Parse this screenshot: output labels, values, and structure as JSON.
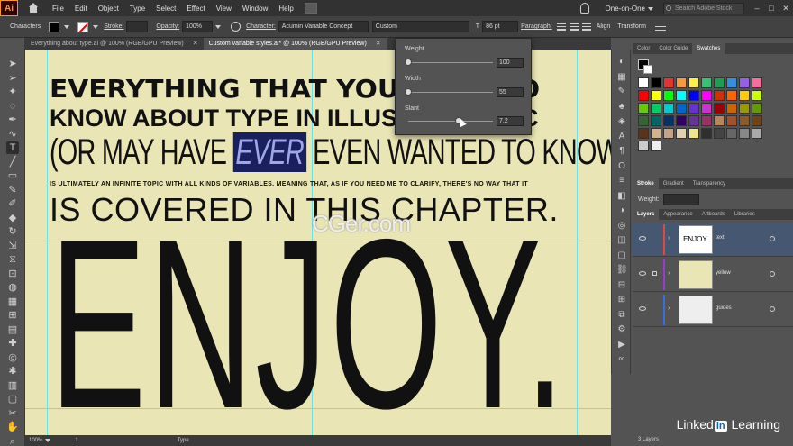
{
  "menubar": {
    "app_logo": "Ai",
    "items": [
      "File",
      "Edit",
      "Object",
      "Type",
      "Select",
      "Effect",
      "View",
      "Window",
      "Help"
    ],
    "workspace": "One-on-One",
    "search_placeholder": "Search Adobe Stock",
    "win_controls": [
      "–",
      "□",
      "✕"
    ]
  },
  "controlbar": {
    "panel_label": "Characters",
    "stroke_label": "Stroke:",
    "opacity_label": "Opacity:",
    "opacity_value": "100%",
    "character_label": "Character:",
    "font_name": "Acumin Variable Concept",
    "font_style": "Custom",
    "font_size": "86 pt",
    "paragraph_label": "Paragraph:",
    "align_label": "Align",
    "transform_label": "Transform"
  },
  "tabs": [
    {
      "label": "Everything about type.ai @ 100% (RGB/GPU Preview)",
      "close": "✕"
    },
    {
      "label": "Custom variable styles.ai* @ 100% (RGB/GPU Preview)",
      "close": "✕"
    }
  ],
  "popup": {
    "weight_label": "Weight",
    "weight_value": "100",
    "weight_fraction": 0.0,
    "width_label": "Width",
    "width_value": "55",
    "width_fraction": 0.0,
    "slant_label": "Slant",
    "slant_value": "7.2",
    "slant_fraction": 0.6
  },
  "artwork": {
    "line1": "EVERYTHING THAT YOU NEED TO",
    "line2": "KNOW ABOUT TYPE IN ILLUSTRATOR CC",
    "line3_before": "(OR MAY HAVE ",
    "line3_highlight": "EVER",
    "line3_after": " EVEN WANTED TO KNOW)",
    "line4": "IS ULTIMATELY AN INFINITE TOPIC WITH ALL KINDS OF VARIABLES. MEANING THAT, AS IF YOU NEED ME TO CLARIFY, THERE'S NO WAY THAT IT",
    "line5": "IS COVERED IN THIS CHAPTER.",
    "line6": "ENJOY.",
    "watermark": "CGer.com"
  },
  "rightpanel": {
    "top_tabs": [
      "Color",
      "Color Guide",
      "Swatches"
    ],
    "stroke_tabs": [
      "Stroke",
      "Gradient",
      "Transparency"
    ],
    "weight_label": "Weight:",
    "layers_tabs": [
      "Layers",
      "Appearance",
      "Artboards",
      "Libraries"
    ],
    "layers": [
      {
        "name": "text",
        "color": "#e04a3a",
        "thumb_text": "ENJOY."
      },
      {
        "name": "yellow",
        "color": "#9b3bd6"
      },
      {
        "name": "guides",
        "color": "#3a6ee0"
      }
    ],
    "layers_count": "3 Layers"
  },
  "swatch_colors": [
    "#ffffff",
    "#000000",
    "#e3342f",
    "#f6993f",
    "#ffed4a",
    "#38c172",
    "#1f9d55",
    "#3490dc",
    "#9561e2",
    "#f66d9b",
    "#ff0000",
    "#ffff00",
    "#00ff00",
    "#00ffff",
    "#0000ff",
    "#ff00ff",
    "#cc3300",
    "#ff6600",
    "#ffcc00",
    "#ccff00",
    "#66cc00",
    "#00cc66",
    "#00cccc",
    "#0066cc",
    "#6633cc",
    "#cc33cc",
    "#990000",
    "#cc6600",
    "#999900",
    "#669900",
    "#336633",
    "#006666",
    "#003366",
    "#330066",
    "#663399",
    "#993366",
    "#b8865b",
    "#a0522d",
    "#8b5a2b",
    "#704214",
    "#5c3317",
    "#d2b48c",
    "#c4a484",
    "#e0d2b0",
    "#f0e68c",
    "#2f2f2f",
    "#444444",
    "#666666",
    "#888888",
    "#aaaaaa",
    "#cccccc",
    "#eeeeee"
  ],
  "statusbar": {
    "zoom": "100%",
    "artboard": "1",
    "tool": "Type"
  },
  "branding": {
    "linkedin_left": "Linked",
    "linkedin_in": "in",
    "linkedin_right": "Learning"
  }
}
